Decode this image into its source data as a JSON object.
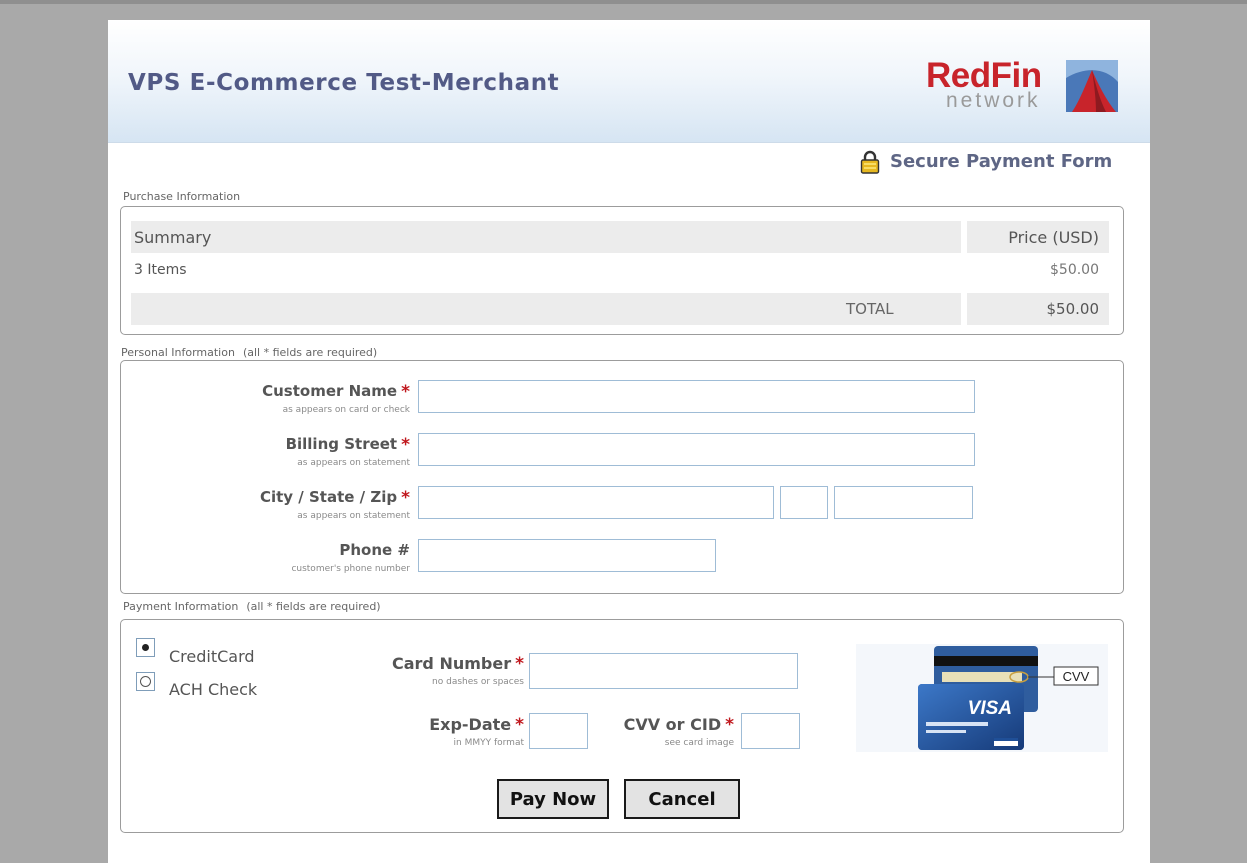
{
  "header": {
    "merchant_name": "VPS E-Commerce Test-Merchant",
    "logo_text_main": "RedFin",
    "logo_text_sub": "network"
  },
  "secure_label": "Secure Payment Form",
  "purchase": {
    "legend": "Purchase Information",
    "col_summary": "Summary",
    "col_price": "Price (USD)",
    "rows": [
      {
        "desc": "3 Items",
        "price": "$50.00"
      }
    ],
    "total_label": "TOTAL",
    "total_value": "$50.00"
  },
  "personal": {
    "legend": "Personal Information",
    "required_note": "(all * fields are required)",
    "fields": {
      "name": {
        "label": "Customer Name",
        "hint": "as appears on card or check",
        "value": ""
      },
      "street": {
        "label": "Billing Street",
        "hint": "as appears on statement",
        "value": ""
      },
      "csz": {
        "label": "City / State / Zip",
        "hint": "as appears on statement",
        "city": "",
        "state": "",
        "zip": ""
      },
      "phone": {
        "label": "Phone #",
        "hint": "customer's phone number",
        "value": ""
      }
    }
  },
  "payment": {
    "legend": "Payment Information",
    "required_note": "(all * fields are required)",
    "methods": [
      {
        "label": "CreditCard",
        "selected": true
      },
      {
        "label": "ACH Check",
        "selected": false
      }
    ],
    "card_number": {
      "label": "Card Number",
      "hint": "no dashes or spaces",
      "value": ""
    },
    "exp_date": {
      "label": "Exp-Date",
      "hint": "in MMYY format",
      "value": ""
    },
    "cvv": {
      "label": "CVV or CID",
      "hint": "see card image",
      "value": ""
    },
    "card_image": {
      "cvv_callout": "CVV",
      "brand": "VISA"
    }
  },
  "buttons": {
    "pay": "Pay Now",
    "cancel": "Cancel"
  },
  "required_marker": "*",
  "colors": {
    "title": "#525a86",
    "required": "#c0181e",
    "logo_red": "#c8242b"
  }
}
